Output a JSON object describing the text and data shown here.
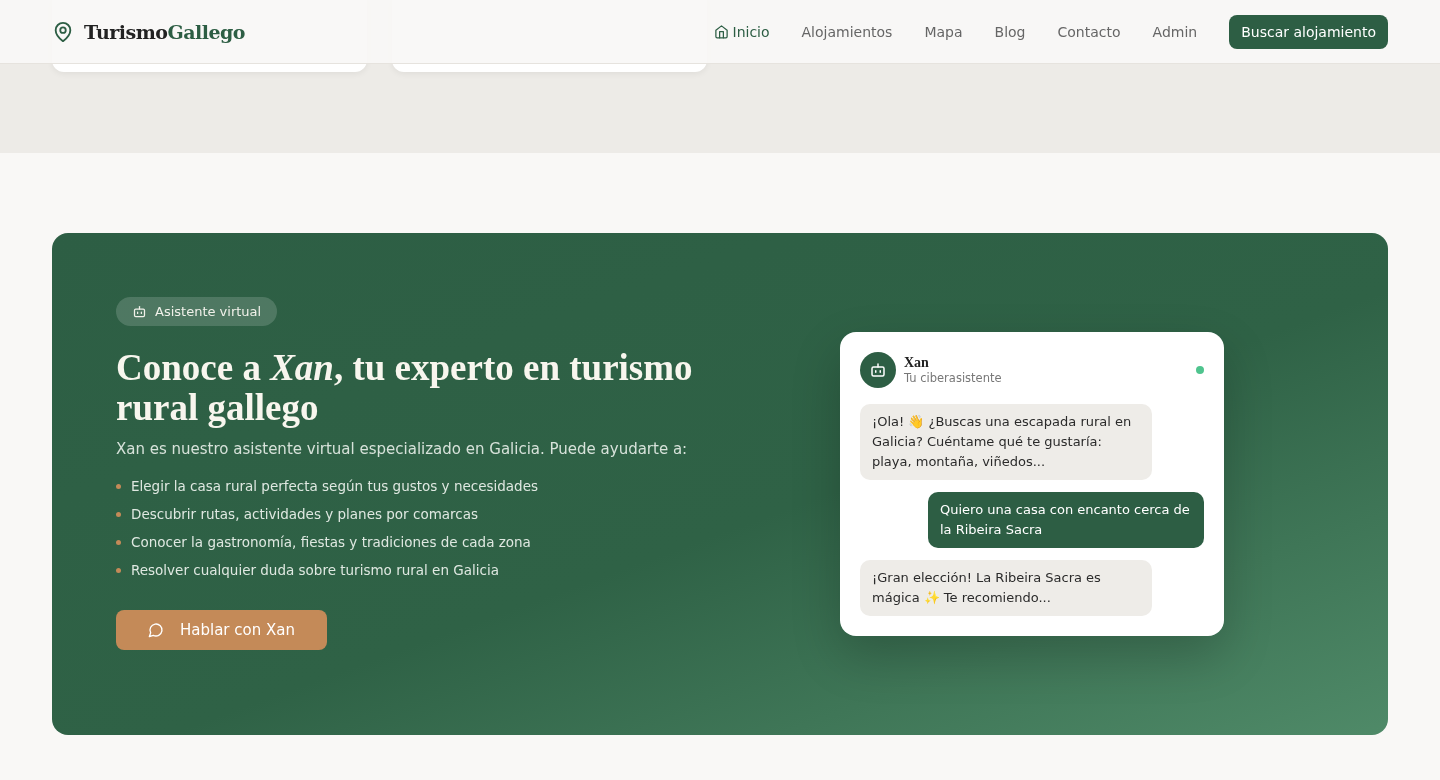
{
  "header": {
    "logo": {
      "first": "Turismo",
      "second": "Gallego"
    },
    "nav": [
      {
        "label": "Inicio",
        "selected": true
      },
      {
        "label": "Alojamientos",
        "selected": false
      },
      {
        "label": "Mapa",
        "selected": false
      },
      {
        "label": "Blog",
        "selected": false
      },
      {
        "label": "Contacto",
        "selected": false
      },
      {
        "label": "Admin",
        "selected": false
      }
    ],
    "cta": "Buscar alojamiento"
  },
  "assistant": {
    "badge": "Asistente virtual",
    "title": "Conoce a *Xan*, tu experto en turismo rural gallego",
    "intro": "Xan es nuestro asistente virtual especializado en Galicia. Puede ayudarte a:",
    "features": [
      "Elegir la casa rural perfecta según tus gustos y necesidades",
      "Descubrir rutas, actividades y planes por comarcas",
      "Conocer la gastronomía, fiestas y tradiciones de cada zona",
      "Resolver cualquier duda sobre turismo rural en Galicia"
    ],
    "button": "Hablar con Xan",
    "chat": {
      "name": "Xan",
      "subtitle": "Tu ciberasistente",
      "online": true,
      "messages": [
        {
          "kind": "bot",
          "text": "¡Ola! 👋 ¿Buscas una escapada rural en Galicia? Cuéntame qué te gustaría: playa, montaña, viñedos..."
        },
        {
          "kind": "user",
          "text": "Quiero una casa con encanto cerca de la Ribeira Sacra"
        },
        {
          "kind": "bot",
          "text": "¡Gran elección! La Ribeira Sacra es mágica ✨ Te recomiendo..."
        }
      ]
    }
  }
}
